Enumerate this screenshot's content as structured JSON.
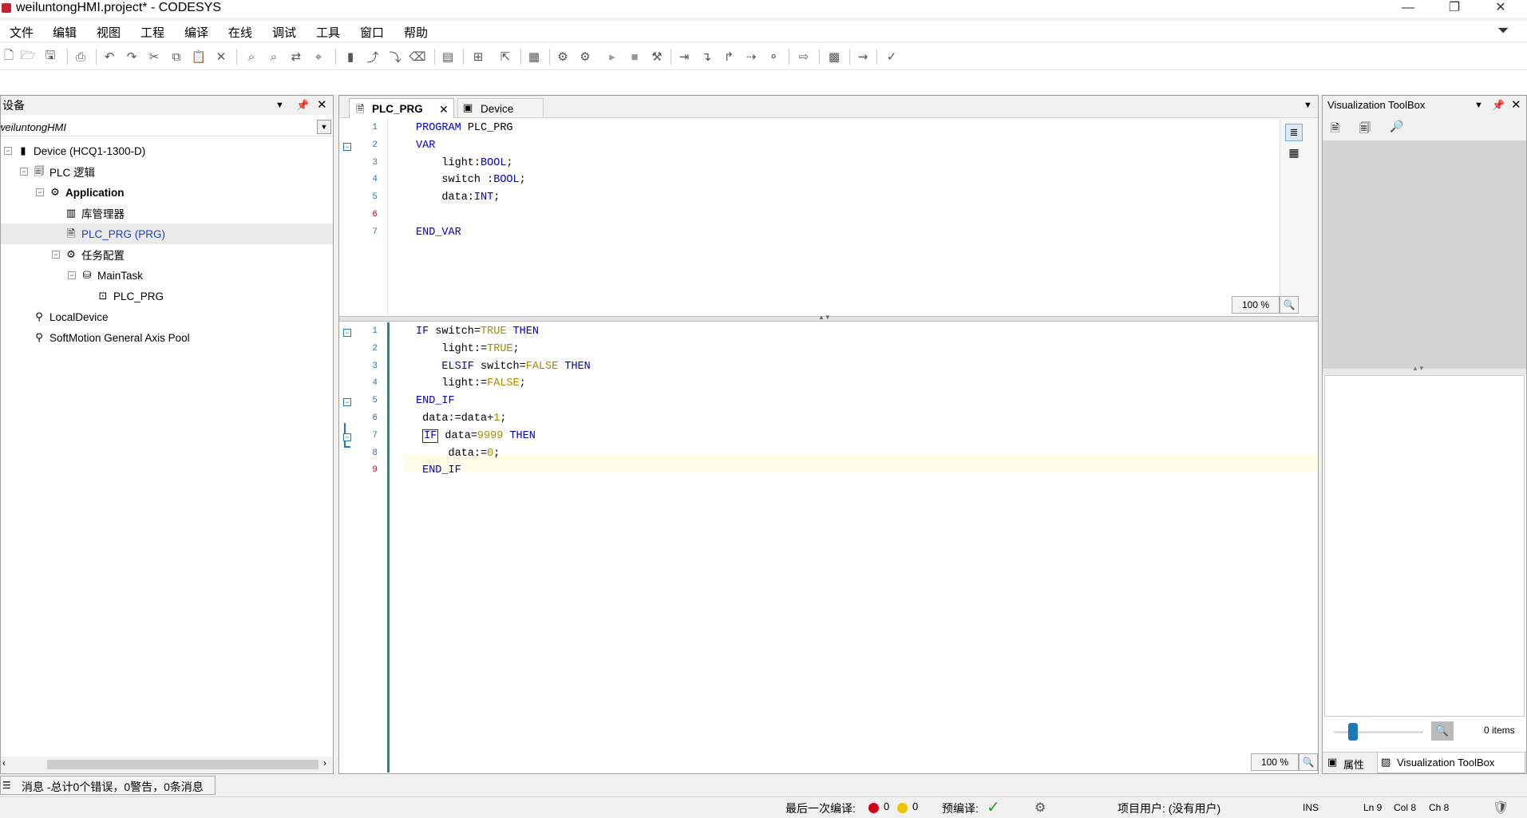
{
  "window": {
    "title": "weiluntongHMI.project* - CODESYS",
    "min": "—",
    "restore": "❐",
    "close": "✕"
  },
  "menu": [
    "文件",
    "编辑",
    "视图",
    "工程",
    "编译",
    "在线",
    "调试",
    "工具",
    "窗口",
    "帮助"
  ],
  "devices_panel": {
    "title": "设备",
    "project_selector": "weiluntongHMI",
    "tree": [
      {
        "label": "Device (HCQ1-1300-D)",
        "indent": 0,
        "icon": "device-icon",
        "expander": "-"
      },
      {
        "label": "PLC 逻辑",
        "indent": 1,
        "icon": "plc-logic-icon",
        "expander": "-"
      },
      {
        "label": "Application",
        "indent": 2,
        "icon": "application-gear-icon",
        "expander": "-",
        "bold": true
      },
      {
        "label": "库管理器",
        "indent": 3,
        "icon": "library-icon",
        "expander": ""
      },
      {
        "label": "PLC_PRG (PRG)",
        "indent": 3,
        "icon": "program-icon",
        "expander": "",
        "selected": true
      },
      {
        "label": "任务配置",
        "indent": 3,
        "icon": "task-config-icon",
        "expander": "-"
      },
      {
        "label": "MainTask",
        "indent": 4,
        "icon": "task-icon",
        "expander": "-"
      },
      {
        "label": "PLC_PRG",
        "indent": 5,
        "icon": "program-call-icon",
        "expander": ""
      },
      {
        "label": "LocalDevice",
        "indent": 1,
        "icon": "local-device-icon",
        "expander": ""
      },
      {
        "label": "SoftMotion General Axis Pool",
        "indent": 1,
        "icon": "axis-pool-icon",
        "expander": ""
      }
    ]
  },
  "editor": {
    "tabs": [
      {
        "label": "PLC_PRG",
        "active": true,
        "close": "✕"
      },
      {
        "label": "Device",
        "active": false
      }
    ],
    "decl_lines": [
      {
        "n": "1",
        "segs": [
          [
            "kw",
            "PROGRAM"
          ],
          [
            "",
            " PLC_PRG"
          ]
        ]
      },
      {
        "n": "2",
        "segs": [
          [
            "kw",
            "VAR"
          ]
        ],
        "fold": "−"
      },
      {
        "n": "3",
        "segs": [
          [
            "",
            "    light:"
          ],
          [
            "kw",
            "BOOL"
          ],
          [
            "",
            ";"
          ]
        ]
      },
      {
        "n": "4",
        "segs": [
          [
            "",
            "    switch :"
          ],
          [
            "kw",
            "BOOL"
          ],
          [
            "",
            ";"
          ]
        ]
      },
      {
        "n": "5",
        "segs": [
          [
            "",
            "    data:"
          ],
          [
            "kw",
            "INT"
          ],
          [
            "",
            ";"
          ]
        ]
      },
      {
        "n": "6",
        "segs": [
          [
            "",
            ""
          ]
        ],
        "red": true
      },
      {
        "n": "7",
        "segs": [
          [
            "kw",
            "END_VAR"
          ]
        ]
      }
    ],
    "impl_lines": [
      {
        "n": "1",
        "fold": "−",
        "segs": [
          [
            "kw",
            "IF"
          ],
          [
            "",
            " switch="
          ],
          [
            "lit",
            "TRUE"
          ],
          [
            "",
            " "
          ],
          [
            "kw",
            "THEN"
          ]
        ]
      },
      {
        "n": "2",
        "segs": [
          [
            "",
            "    light:="
          ],
          [
            "lit",
            "TRUE"
          ],
          [
            "",
            ";"
          ]
        ]
      },
      {
        "n": "3",
        "segs": [
          [
            "",
            "    "
          ],
          [
            "kw",
            "ELSIF"
          ],
          [
            "",
            " switch="
          ],
          [
            "lit",
            "FALSE"
          ],
          [
            "",
            " "
          ],
          [
            "kw",
            "THEN"
          ]
        ]
      },
      {
        "n": "4",
        "segs": [
          [
            "",
            "    light:="
          ],
          [
            "lit",
            "FALSE"
          ],
          [
            "",
            ";"
          ]
        ]
      },
      {
        "n": "5",
        "fold": "−",
        "segs": [
          [
            "kw",
            "END_IF"
          ]
        ]
      },
      {
        "n": "6",
        "segs": [
          [
            "",
            " data:=data+"
          ],
          [
            "lit",
            "1"
          ],
          [
            "",
            ";"
          ]
        ]
      },
      {
        "n": "7",
        "fold": "−",
        "segs": [
          [
            "",
            " "
          ],
          [
            "kwbox",
            "IF"
          ],
          [
            "",
            " data="
          ],
          [
            "lit",
            "9999"
          ],
          [
            "",
            " "
          ],
          [
            "kw",
            "THEN"
          ]
        ]
      },
      {
        "n": "8",
        "segs": [
          [
            "",
            "     data:="
          ],
          [
            "lit",
            "0"
          ],
          [
            "",
            ";"
          ]
        ]
      },
      {
        "n": "9",
        "segs": [
          [
            "",
            " "
          ],
          [
            "kw",
            "END_IF"
          ]
        ],
        "red": true,
        "current": true
      }
    ],
    "zoom_top": "100 %",
    "zoom_bottom": "100 %"
  },
  "toolbox": {
    "title": "Visualization ToolBox",
    "items_count": "0 items",
    "bottom_tabs": [
      "属性",
      "Visualization ToolBox"
    ]
  },
  "messages_tab": "消息 -总计0个错误，0警告，0条消息",
  "statusbar": {
    "last_compile": "最后一次编译:",
    "errors": "0",
    "warnings": "0",
    "precompile": "预编译:",
    "project_user": "项目用户: (没有用户)",
    "ins": "INS",
    "ln": "Ln 9",
    "col": "Col 8",
    "ch": "Ch 8"
  },
  "colors": {
    "accent": "#1e77b8",
    "keyword": "#0000c8",
    "literal": "#a28a00",
    "error": "#d0021b",
    "ok": "#1aa31a"
  }
}
